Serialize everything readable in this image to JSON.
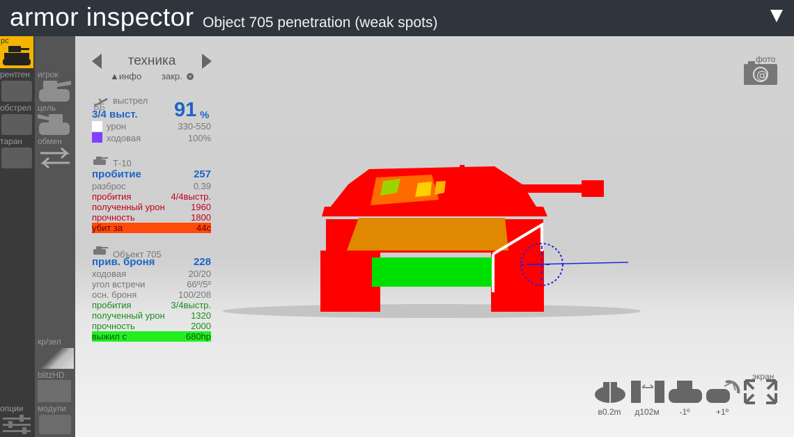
{
  "header": {
    "app_title": "armor inspector",
    "subtitle": "Object 705 penetration (weak spots)"
  },
  "sidebar": {
    "items": [
      {
        "label": "рс",
        "icon": "tank-silhouette-icon",
        "active": true
      },
      {
        "label": "рентген",
        "icon": "xray-icon"
      },
      {
        "label": "игрок",
        "icon": "player-tank-icon"
      },
      {
        "label": "обстрел",
        "icon": "shooting-icon"
      },
      {
        "label": "цель",
        "icon": "target-tank-icon"
      },
      {
        "label": "таран",
        "icon": "ram-icon"
      },
      {
        "label": "обмен",
        "icon": "swap-arrows-icon"
      },
      {
        "label": "кр/зел",
        "icon": "color-scheme-icon"
      },
      {
        "label": "blitzHD",
        "icon": "hd-texture-icon"
      },
      {
        "label": "опции",
        "icon": "sliders-icon"
      },
      {
        "label": "модули",
        "icon": "modules-icon"
      }
    ]
  },
  "panel": {
    "nav_title": "техника",
    "info_link": "▲инфо",
    "close_link": "закр.",
    "shot": {
      "header": "выстрел",
      "shell_type": "ББ",
      "label": "3/4 выст.",
      "percent_value": "91",
      "percent_unit": "%",
      "damage_label": "урон",
      "damage_value": "330-550",
      "tracks_label": "ходовая",
      "tracks_value": "100%"
    },
    "attacker": {
      "name": "Т-10",
      "penetration_label": "пробитие",
      "penetration_value": "257",
      "spread_label": "разброс",
      "spread_value": "0.39",
      "pens_label": "пробития",
      "pens_value": "4/4выстр.",
      "dmg_taken_label": "полученный урон",
      "dmg_taken_value": "1960",
      "hp_label": "прочность",
      "hp_value": "1800",
      "result_label": "убит за",
      "result_value": "44с"
    },
    "defender": {
      "name": "Объект 705",
      "armor_label": "прив. броня",
      "armor_value": "228",
      "tracks_label": "ходовая",
      "tracks_value": "20/20",
      "angle_label": "угол встречи",
      "angle_value": "66º/5º",
      "base_armor_label": "осн. броня",
      "base_armor_value": "100/208",
      "pens_label": "пробития",
      "pens_value": "3/4выстр.",
      "dmg_taken_label": "полученный урон",
      "dmg_taken_value": "1320",
      "hp_label": "прочность",
      "hp_value": "2000",
      "result_label": "выжил с",
      "result_value": "680hp"
    }
  },
  "viewport": {
    "photo_label": "фото",
    "screen_label": "экран",
    "controls": [
      {
        "icon": "elevation-icon",
        "label": "в0.2m"
      },
      {
        "icon": "distance-icon",
        "label": "д102м"
      },
      {
        "icon": "tilt-down-icon",
        "label": "-1º"
      },
      {
        "icon": "tilt-up-icon",
        "label": "+1º"
      },
      {
        "icon": "fullscreen-icon",
        "label": ""
      }
    ]
  },
  "colors": {
    "header_bg": "#2e353c",
    "accent_active": "#f4b400",
    "stat_blue": "#1f63c6",
    "stat_red": "#c0001a",
    "stat_green": "#1c8c1c",
    "hit_red": "#ff0000",
    "hit_orange": "#e08800",
    "hit_green": "#00e000"
  }
}
